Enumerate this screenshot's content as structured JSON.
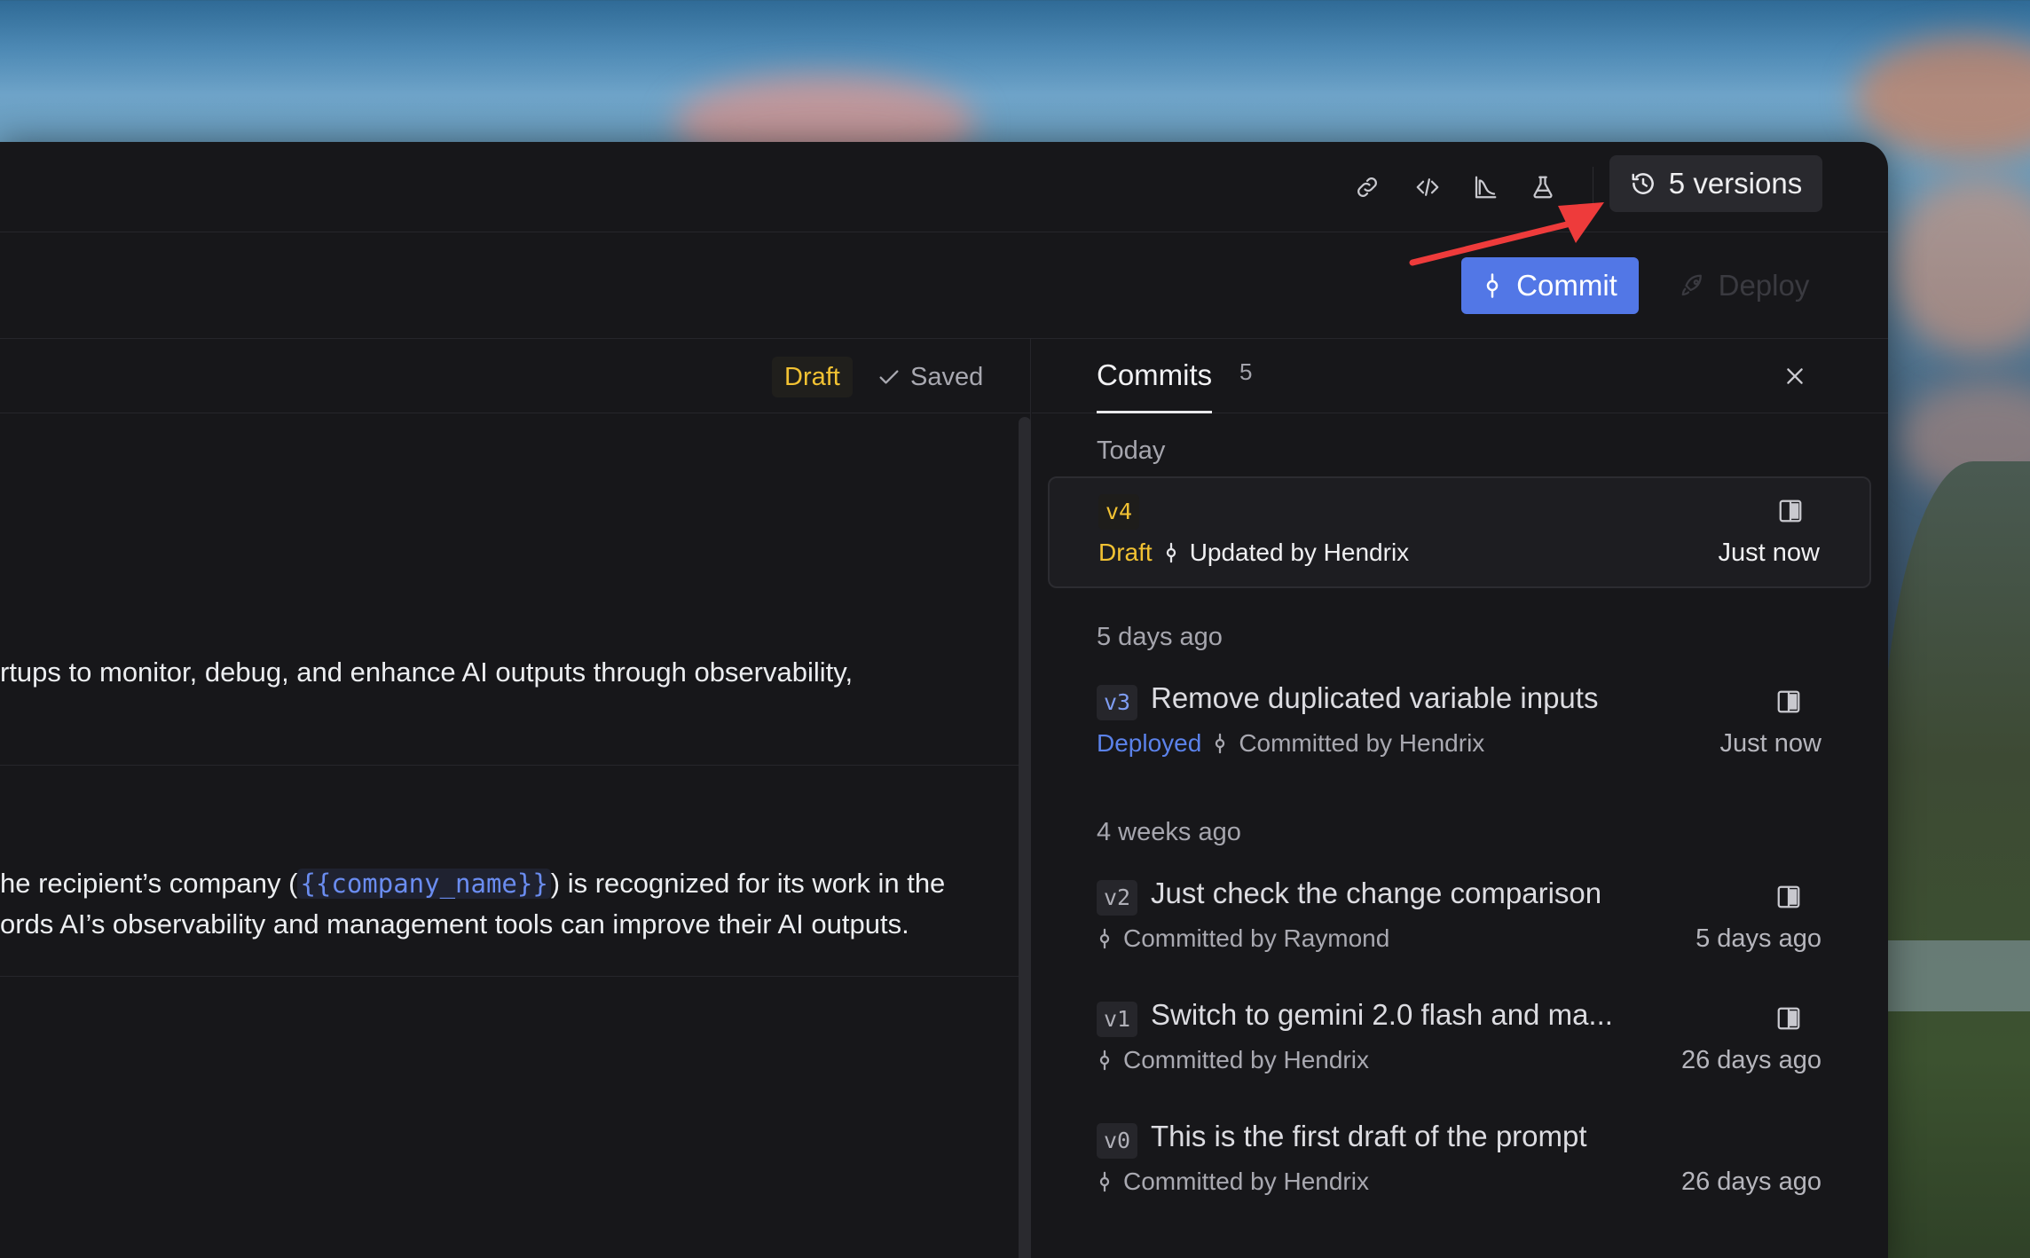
{
  "toolbar": {
    "versions_label": "5 versions",
    "commit_label": "Commit",
    "deploy_label": "Deploy"
  },
  "editor": {
    "status_badge": "Draft",
    "saved_label": "Saved",
    "line1": "rtups to monitor, debug, and enhance AI outputs through observability,",
    "line2_before": "he recipient’s company (",
    "line2_var": "{{company_name}}",
    "line2_after": ") is recognized for its work in the",
    "line3": "ords AI’s observability and management tools can improve their AI outputs."
  },
  "commits_panel": {
    "tab_label": "Commits",
    "tab_count": "5",
    "groups": [
      {
        "label": "Today"
      },
      {
        "label": "5 days ago"
      },
      {
        "label": "4 weeks ago"
      }
    ],
    "items": [
      {
        "version": "v4",
        "title": "",
        "status": "Draft",
        "by": "Updated by Hendrix",
        "time": "Just now"
      },
      {
        "version": "v3",
        "title": "Remove duplicated variable inputs",
        "status": "Deployed",
        "by": "Committed by Hendrix",
        "time": "Just now"
      },
      {
        "version": "v2",
        "title": "Just check the change comparison",
        "status": "",
        "by": "Committed by Raymond",
        "time": "5 days ago"
      },
      {
        "version": "v1",
        "title": "Switch to gemini 2.0 flash and ma...",
        "status": "",
        "by": "Committed by Hendrix",
        "time": "26 days ago"
      },
      {
        "version": "v0",
        "title": "This is the first draft of the prompt",
        "status": "",
        "by": "Committed by Hendrix",
        "time": "26 days ago"
      }
    ]
  },
  "colors": {
    "accent": "#5277e6",
    "draft": "#f2c233",
    "deployed": "#5b82ea",
    "annotation": "#ee3b3b",
    "window_bg": "#17171a"
  },
  "icons": [
    "link-icon",
    "code-icon",
    "chart-icon",
    "flask-icon",
    "history-icon",
    "commit-icon",
    "rocket-icon",
    "check-icon",
    "close-icon",
    "compare-icon"
  ]
}
